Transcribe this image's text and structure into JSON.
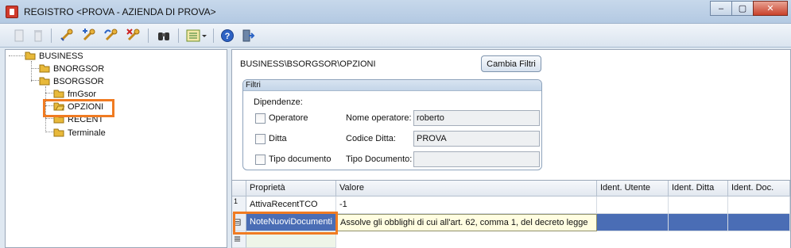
{
  "window": {
    "title": "REGISTRO <PROVA - AZIENDA DI PROVA>",
    "minimize": "‒",
    "maximize": "▢",
    "close": "✕"
  },
  "toolbar": {
    "icons": [
      "new-icon",
      "delete-icon",
      "edit-key-icon",
      "add-key-icon",
      "rename-key-icon",
      "remove-key-icon",
      "binoculars-icon",
      "view-list-icon",
      "help-icon",
      "exit-icon"
    ]
  },
  "tree": {
    "root": "BUSINESS",
    "items": [
      {
        "label": "BNORGSOR"
      },
      {
        "label": "BSORGSOR"
      },
      {
        "label": "fmGsor"
      },
      {
        "label": "OPZIONI"
      },
      {
        "label": "RECENT"
      },
      {
        "label": "Terminale"
      }
    ]
  },
  "panel": {
    "path": "BUSINESS\\BSORGSOR\\OPZIONI",
    "cambia_filtri": "Cambia Filtri",
    "filtri": {
      "title": "Filtri",
      "dipendenze": "Dipendenze:",
      "operatore": "Operatore",
      "ditta": "Ditta",
      "tipo_documento": "Tipo documento",
      "nome_operatore_label": "Nome operatore:",
      "nome_operatore_value": "roberto",
      "codice_ditta_label": "Codice Ditta:",
      "codice_ditta_value": "PROVA",
      "tipo_documento_label": "Tipo Documento:",
      "tipo_documento_value": ""
    }
  },
  "grid": {
    "columns": [
      "Proprietà",
      "Valore",
      "Ident. Utente",
      "Ident. Ditta",
      "Ident. Doc."
    ],
    "rows": [
      {
        "index": "1",
        "prop": "AttivaRecentTCO",
        "value": "-1",
        "utente": "",
        "ditta": "",
        "doc": ""
      },
      {
        "index": "",
        "prop": "NoteNuoviDocumenti",
        "value": "Assolve gli obblighi di cui all'art. 62, comma 1, del decreto legge",
        "utente": "",
        "ditta": "",
        "doc": ""
      }
    ]
  },
  "colors": {
    "highlight": "#f07b22",
    "selection": "#4a6db5",
    "editing_cell": "#fffde0"
  }
}
